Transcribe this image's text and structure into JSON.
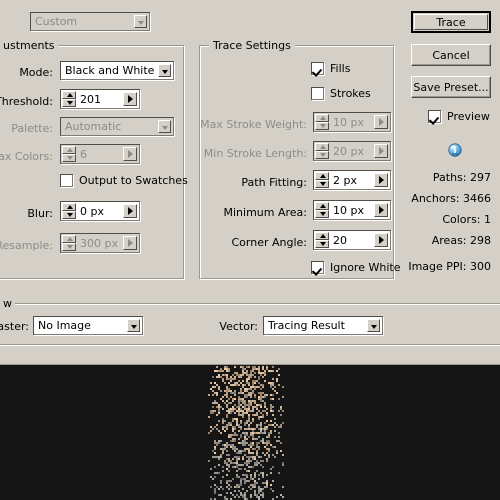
{
  "dialog": {
    "preset": {
      "value": "Custom",
      "icon": "chevron-down-icon"
    },
    "adjustments": {
      "title": "ustments",
      "mode": {
        "label": "Mode:",
        "value": "Black and White"
      },
      "threshold": {
        "label": "Threshold:",
        "value": "201"
      },
      "palette": {
        "label": "Palette:",
        "value": "Automatic"
      },
      "max_colors": {
        "label": "Max Colors:",
        "value": "6"
      },
      "output_to_swatches": {
        "label": "Output to Swatches",
        "checked": false
      },
      "blur": {
        "label": "Blur:",
        "value": "0 px"
      },
      "resample": {
        "label": "Resample:",
        "value": "300 px"
      }
    },
    "trace_settings": {
      "title": "Trace Settings",
      "fills": {
        "label": "Fills",
        "checked": true
      },
      "strokes": {
        "label": "Strokes",
        "checked": false
      },
      "max_stroke_weight": {
        "label": "Max Stroke Weight:",
        "value": "10 px"
      },
      "min_stroke_length": {
        "label": "Min Stroke Length:",
        "value": "20 px"
      },
      "path_fitting": {
        "label": "Path Fitting:",
        "value": "2 px"
      },
      "minimum_area": {
        "label": "Minimum Area:",
        "value": "10 px"
      },
      "corner_angle": {
        "label": "Corner Angle:",
        "value": "20"
      },
      "ignore_white": {
        "label": "Ignore White",
        "checked": true
      }
    },
    "preview_group": {
      "title": "w",
      "raster": {
        "label": "aster:",
        "value": "No Image"
      },
      "vector": {
        "label": "Vector:",
        "value": "Tracing Result"
      }
    },
    "buttons": {
      "trace": "Trace",
      "cancel": "Cancel",
      "save_preset": "Save Preset..."
    },
    "preview_checkbox": {
      "label": "Preview",
      "checked": true
    },
    "stats": [
      "Paths: 297",
      "Anchors: 3466",
      "Colors: 1",
      "Areas: 298",
      "Image PPI: 300"
    ]
  },
  "colors": {
    "dialog_bg": "#d4d0c8",
    "canvas_bg": "#151515",
    "disabled_text": "#8e8b84",
    "trace_tan": "#f2cda6",
    "trace_grey": "#b8b5ad"
  },
  "canvas": {
    "description": "traced-image-preview"
  }
}
